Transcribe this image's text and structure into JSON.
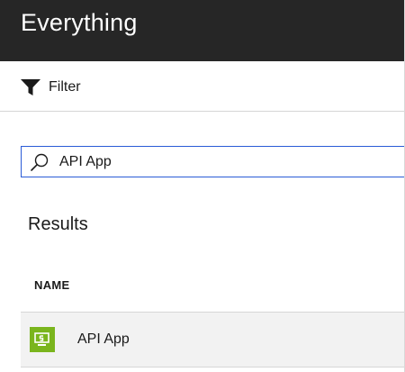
{
  "header": {
    "title": "Everything"
  },
  "toolbar": {
    "filter_label": "Filter"
  },
  "search": {
    "value": "API App",
    "icon": "search-icon"
  },
  "results": {
    "heading": "Results",
    "columns": [
      "NAME"
    ],
    "rows": [
      {
        "name": "API App",
        "icon": "api-app-icon",
        "icon_color": "#7ab51d"
      }
    ]
  },
  "colors": {
    "header_bg": "#262626",
    "search_border": "#2a5bd7",
    "row_bg": "#f2f2f2"
  }
}
